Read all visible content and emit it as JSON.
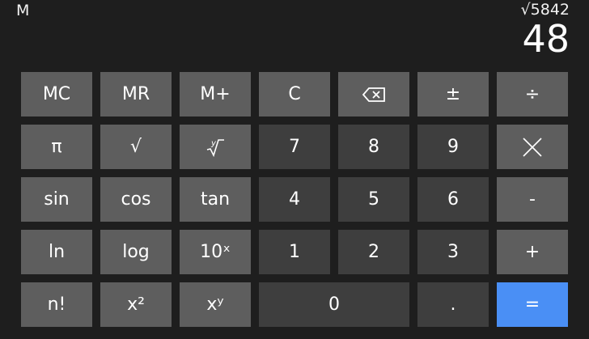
{
  "display": {
    "memory_indicator": "M",
    "expression": "√5842",
    "result": "48"
  },
  "keys": {
    "row1": {
      "mc": "MC",
      "mr": "MR",
      "mplus": "M+",
      "clear": "C",
      "backspace_icon": "backspace-icon",
      "plusminus": "±",
      "divide": "÷"
    },
    "row2": {
      "pi": "π",
      "sqrt": "√",
      "yroot": "∛",
      "seven": "7",
      "eight": "8",
      "nine": "9",
      "multiply_icon": "multiply-icon"
    },
    "row3": {
      "sin": "sin",
      "cos": "cos",
      "tan": "tan",
      "four": "4",
      "five": "5",
      "six": "6",
      "minus": "-"
    },
    "row4": {
      "ln": "ln",
      "log": "log",
      "ten_power": "10ˣ",
      "one": "1",
      "two": "2",
      "three": "3",
      "plus": "+"
    },
    "row5": {
      "factorial": "n!",
      "square": "x²",
      "power": "xʸ",
      "zero": "0",
      "decimal": ".",
      "equals": "="
    }
  },
  "colors": {
    "background": "#1e1e1e",
    "function_key": "#5e5e5e",
    "number_key": "#3e3e3e",
    "equals_key": "#4a8ff5"
  }
}
